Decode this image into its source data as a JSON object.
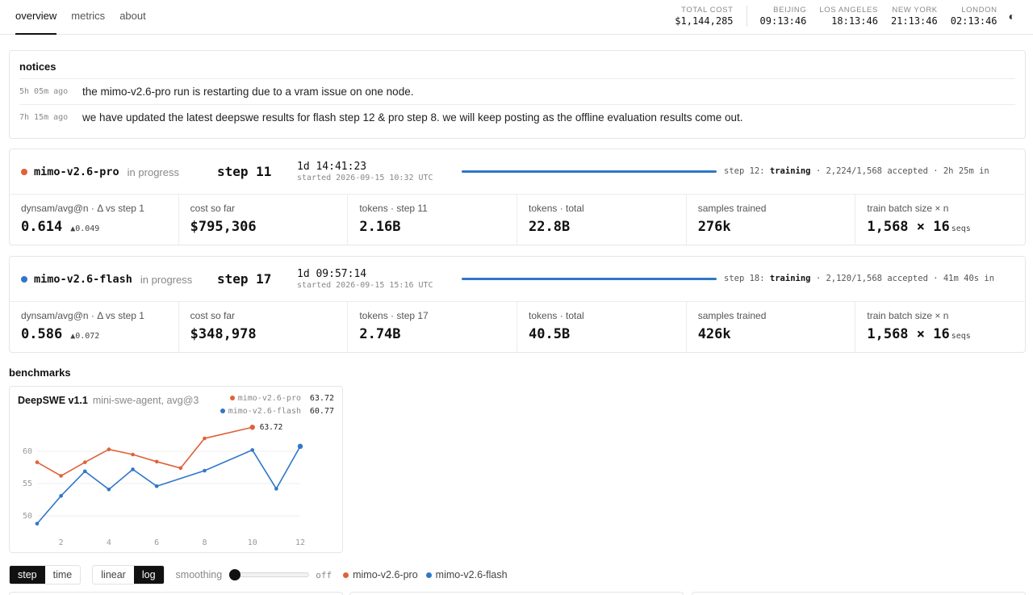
{
  "nav": {
    "tabs": [
      "overview",
      "metrics",
      "about"
    ],
    "active": "overview"
  },
  "header": {
    "total_cost_label": "TOTAL COST",
    "total_cost": "$1,144,285",
    "clocks": [
      {
        "label": "BEIJING",
        "time": "09:13:46"
      },
      {
        "label": "LOS ANGELES",
        "time": "18:13:46"
      },
      {
        "label": "NEW YORK",
        "time": "21:13:46"
      },
      {
        "label": "LONDON",
        "time": "02:13:46"
      }
    ],
    "theme_icon": "half-circle-icon"
  },
  "notices": {
    "title": "notices",
    "items": [
      {
        "ago": "5h 05m ago",
        "text": "the mimo-v2.6-pro run is restarting due to a vram issue on one node."
      },
      {
        "ago": "7h 15m ago",
        "text": "we have updated the latest deepswe results for flash step 12 & pro step 8. we will keep posting as the offline evaluation results come out."
      }
    ]
  },
  "runs": [
    {
      "name": "mimo-v2.6-pro",
      "status": "in progress",
      "color": "#e0613a",
      "step": "step 11",
      "elapsed": "1d 14:41:23",
      "started": "started 2026-09-15 10:32 UTC",
      "progress": 1.0,
      "next_step": "step 12:",
      "phase": "training",
      "accepted": "· 2,224/1,568 accepted · 2h 25m in",
      "metrics": [
        {
          "label": "dynsam/avg@n · Δ vs step 1",
          "value": "0.614",
          "delta": "▲0.049"
        },
        {
          "label": "cost so far",
          "value": "$795,306"
        },
        {
          "label": "tokens · step 11",
          "value": "2.16B"
        },
        {
          "label": "tokens · total",
          "value": "22.8B"
        },
        {
          "label": "samples trained",
          "value": "276k"
        },
        {
          "label": "train batch size × n",
          "value": "1,568 × 16",
          "unit": "seqs"
        }
      ]
    },
    {
      "name": "mimo-v2.6-flash",
      "status": "in progress",
      "color": "#2f77c8",
      "step": "step 17",
      "elapsed": "1d 09:57:14",
      "started": "started 2026-09-15 15:16 UTC",
      "progress": 1.0,
      "next_step": "step 18:",
      "phase": "training",
      "accepted": "· 2,120/1,568 accepted · 41m 40s in",
      "metrics": [
        {
          "label": "dynsam/avg@n · Δ vs step 1",
          "value": "0.586",
          "delta": "▲0.072"
        },
        {
          "label": "cost so far",
          "value": "$348,978"
        },
        {
          "label": "tokens · step 17",
          "value": "2.74B"
        },
        {
          "label": "tokens · total",
          "value": "40.5B"
        },
        {
          "label": "samples trained",
          "value": "426k"
        },
        {
          "label": "train batch size × n",
          "value": "1,568 × 16",
          "unit": "seqs"
        }
      ]
    }
  ],
  "benchmarks": {
    "title": "benchmarks",
    "chart_title": "DeepSWE v1.1",
    "chart_subtitle": "mini-swe-agent, avg@3"
  },
  "chart_data": {
    "type": "line",
    "xlim": [
      1,
      12
    ],
    "ylim": [
      48,
      65
    ],
    "xticks": [
      2,
      4,
      6,
      8,
      10,
      12
    ],
    "yticks": [
      50,
      55,
      60
    ],
    "grid": true,
    "legend": "top-right",
    "series": [
      {
        "name": "mimo-v2.6-pro",
        "color": "#e0613a",
        "latest": "63.72",
        "x": [
          1,
          2,
          3,
          4,
          5,
          6,
          7,
          8,
          10
        ],
        "y": [
          58.3,
          56.2,
          58.3,
          60.3,
          59.5,
          58.4,
          57.4,
          62.0,
          63.72
        ]
      },
      {
        "name": "mimo-v2.6-flash",
        "color": "#2f77c8",
        "latest": "60.77",
        "x": [
          1,
          2,
          3,
          4,
          5,
          6,
          8,
          10,
          11,
          12
        ],
        "y": [
          48.8,
          53.1,
          56.9,
          54.1,
          57.2,
          54.6,
          57.0,
          60.2,
          54.2,
          60.77
        ]
      }
    ]
  },
  "controls": {
    "axis_mode": [
      "step",
      "time"
    ],
    "axis_active": "step",
    "scale": [
      "linear",
      "log"
    ],
    "scale_active": "log",
    "smoothing_label": "smoothing",
    "smoothing_value": "off",
    "legend": [
      {
        "name": "mimo-v2.6-pro",
        "color": "#e0613a"
      },
      {
        "name": "mimo-v2.6-flash",
        "color": "#2f77c8"
      }
    ]
  }
}
